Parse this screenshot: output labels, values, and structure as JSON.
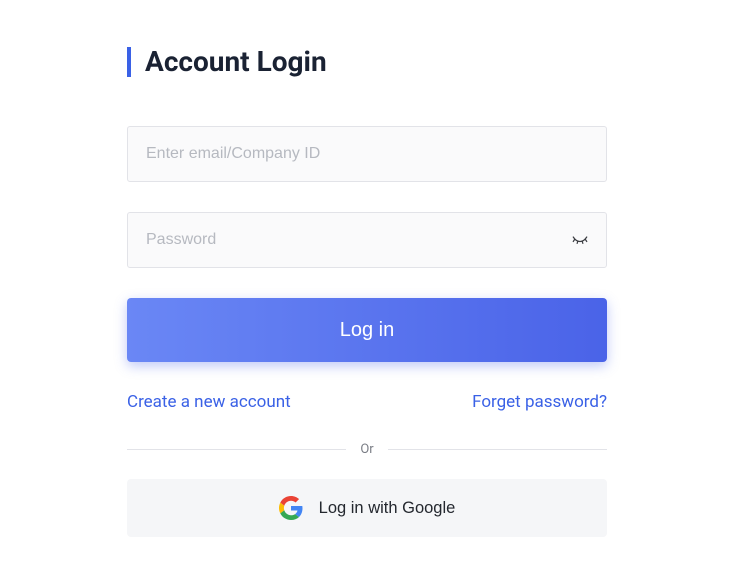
{
  "title": "Account Login",
  "email": {
    "placeholder": "Enter email/Company ID",
    "value": ""
  },
  "password": {
    "placeholder": "Password",
    "value": ""
  },
  "login_button": "Log in",
  "create_account_link": "Create a new account",
  "forget_password_link": "Forget password?",
  "divider_text": "Or",
  "google_button": "Log in with Google",
  "colors": {
    "accent": "#3a61e6",
    "gradient_start": "#6a87f5",
    "gradient_end": "#4a63e8"
  }
}
